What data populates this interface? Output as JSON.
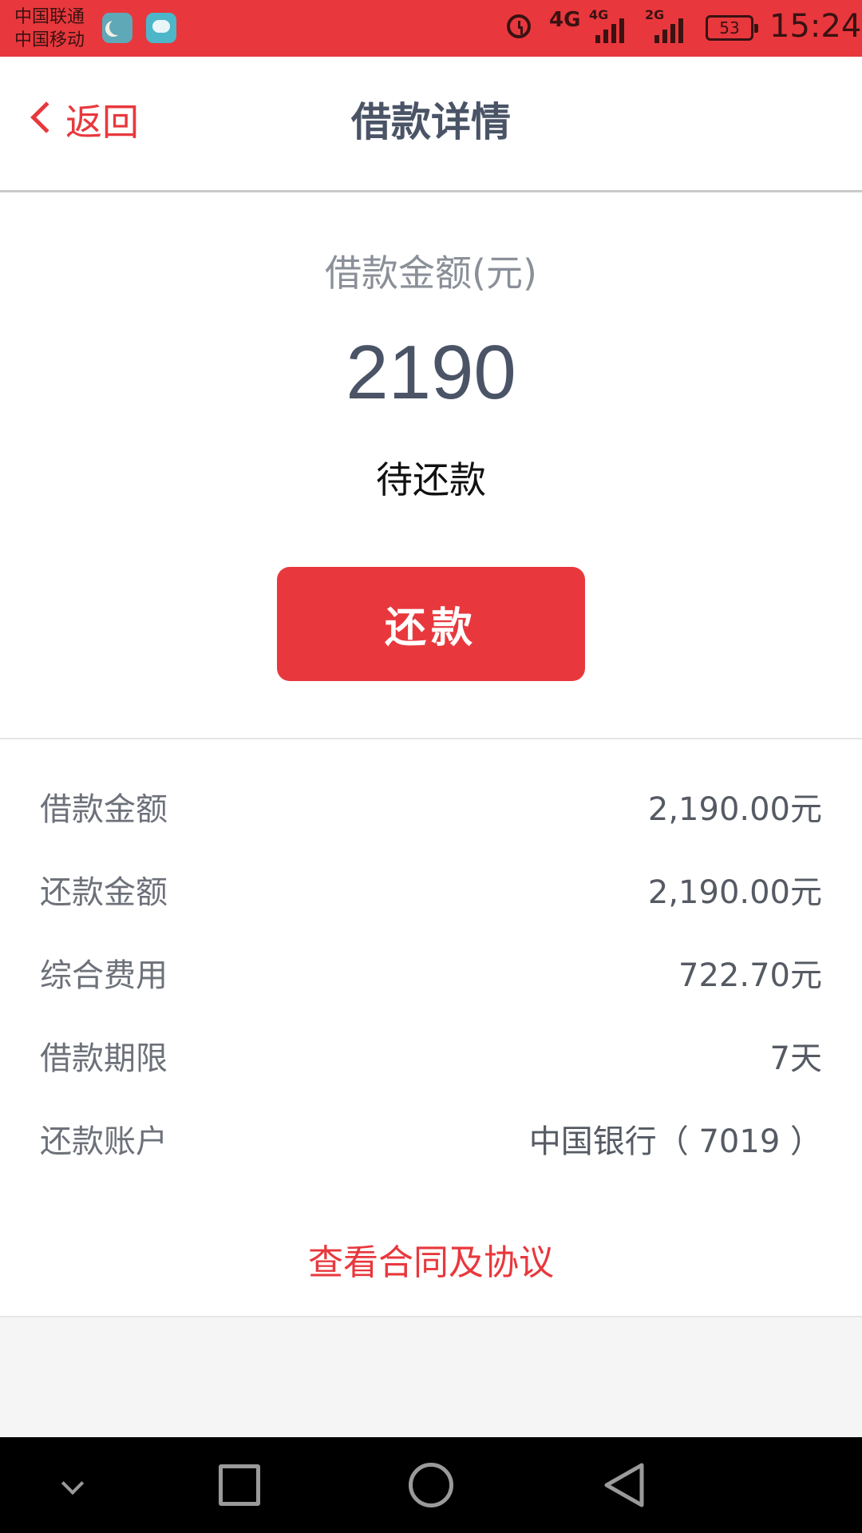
{
  "status_bar": {
    "carrier_1": "中国联通",
    "carrier_2": "中国移动",
    "network_1": "4G",
    "network_2": "4G",
    "network_3": "2G",
    "battery": "53",
    "time": "15:24",
    "icons": [
      "moon-icon",
      "message-icon",
      "alarm-icon",
      "signal-icon",
      "battery-icon"
    ]
  },
  "nav": {
    "back_label": "返回",
    "title": "借款详情"
  },
  "hero": {
    "caption": "借款金额(元)",
    "amount": "2190",
    "status": "待还款",
    "button_label": "还款"
  },
  "details": [
    {
      "label": "借款金额",
      "value": "2,190.00元"
    },
    {
      "label": "还款金额",
      "value": "2,190.00元"
    },
    {
      "label": "综合费用",
      "value": "722.70元"
    },
    {
      "label": "借款期限",
      "value": "7天"
    },
    {
      "label": "还款账户",
      "value": "中国银行（ 7019 ）"
    }
  ],
  "contract_link": "查看合同及协议",
  "colors": {
    "accent": "#e8383d",
    "title": "#4a5466"
  }
}
